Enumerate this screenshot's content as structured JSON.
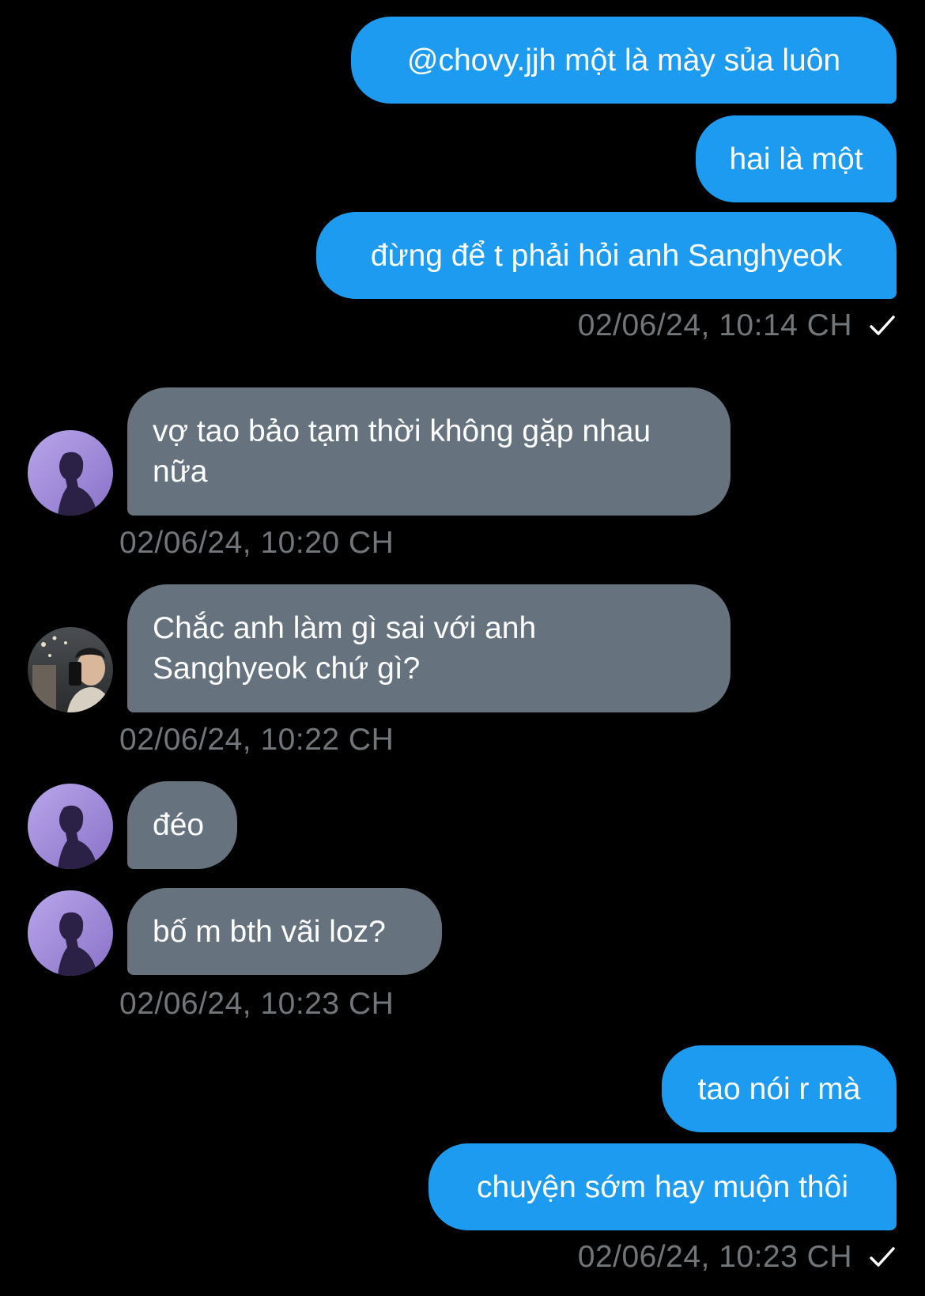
{
  "colors": {
    "background": "#000000",
    "sent_bubble": "#1d9bf0",
    "received_bubble": "#66737f",
    "timestamp": "#71767b",
    "text": "#ffffff"
  },
  "messages": {
    "m1": "@chovy.jjh một là mày sủa luôn",
    "m2": "hai là một",
    "m3": "đừng để t phải hỏi anh Sanghyeok",
    "ts1": "02/06/24, 10:14 CH",
    "m4": "vợ tao bảo tạm thời không gặp nhau nữa",
    "ts2": "02/06/24, 10:20 CH",
    "m5": "Chắc anh làm gì sai với anh Sanghyeok chứ gì?",
    "ts3": "02/06/24, 10:22 CH",
    "m6": "đéo",
    "m7": "bố m bth vãi loz?",
    "ts4": "02/06/24, 10:23 CH",
    "m8": "tao nói r mà",
    "m9": "chuyện sớm hay muộn thôi",
    "ts5": "02/06/24, 10:23 CH"
  },
  "icons": {
    "read_receipt": "checkmark-icon",
    "avatar_purple": "silhouette-avatar",
    "avatar_photo": "selfie-avatar"
  }
}
